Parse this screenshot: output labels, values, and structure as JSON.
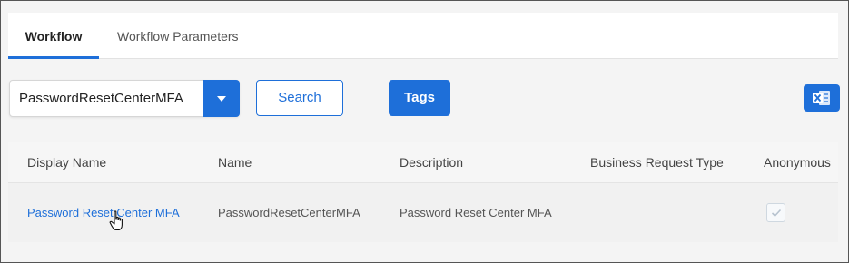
{
  "tabs": [
    {
      "label": "Workflow",
      "active": true
    },
    {
      "label": "Workflow Parameters",
      "active": false
    }
  ],
  "toolbar": {
    "workflow_select_value": "PasswordResetCenterMFA",
    "search_label": "Search",
    "tags_label": "Tags",
    "export_icon": "excel-icon"
  },
  "grid": {
    "columns": [
      "Display Name",
      "Name",
      "Description",
      "Business Request Type",
      "Anonymous"
    ],
    "rows": [
      {
        "display_name": "Password Reset Center MFA",
        "name": "PasswordResetCenterMFA",
        "description": "Password Reset Center MFA",
        "business_request_type": "",
        "anonymous": true
      }
    ]
  },
  "colors": {
    "accent": "#1e6fd9",
    "frame_border": "#555555",
    "background": "#f4f4f4"
  }
}
